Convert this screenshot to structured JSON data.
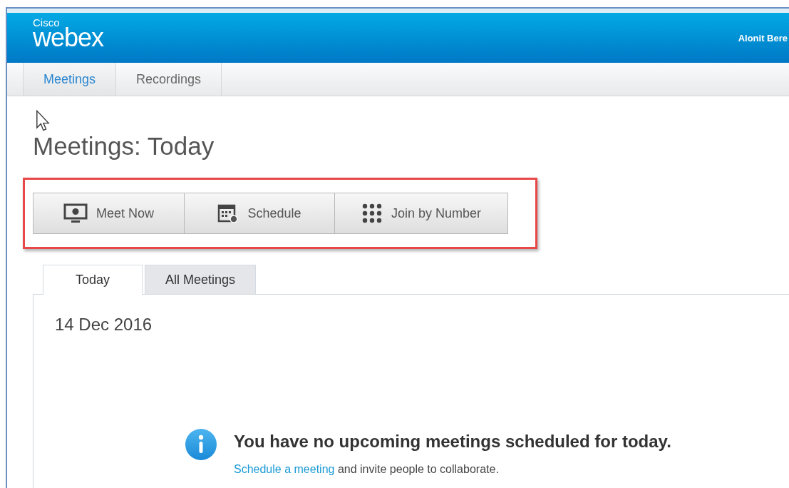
{
  "header": {
    "logo_small": "Cisco",
    "logo_large": "webex",
    "user": "Alonit Bere"
  },
  "nav_tabs": [
    {
      "label": "Meetings",
      "selected": true
    },
    {
      "label": "Recordings",
      "selected": false
    }
  ],
  "page_title": "Meetings: Today",
  "actions": [
    {
      "label": "Meet Now",
      "kind": "monitor"
    },
    {
      "label": "Schedule",
      "kind": "calendar"
    },
    {
      "label": "Join by Number",
      "kind": "keypad"
    }
  ],
  "view_tabs": [
    {
      "label": "Today",
      "selected": true
    },
    {
      "label": "All Meetings",
      "selected": false
    }
  ],
  "date": "14 Dec 2016",
  "notice": {
    "title": "You have no upcoming meetings scheduled for today.",
    "link": "Schedule a meeting",
    "text": "and invite people to collaborate."
  }
}
